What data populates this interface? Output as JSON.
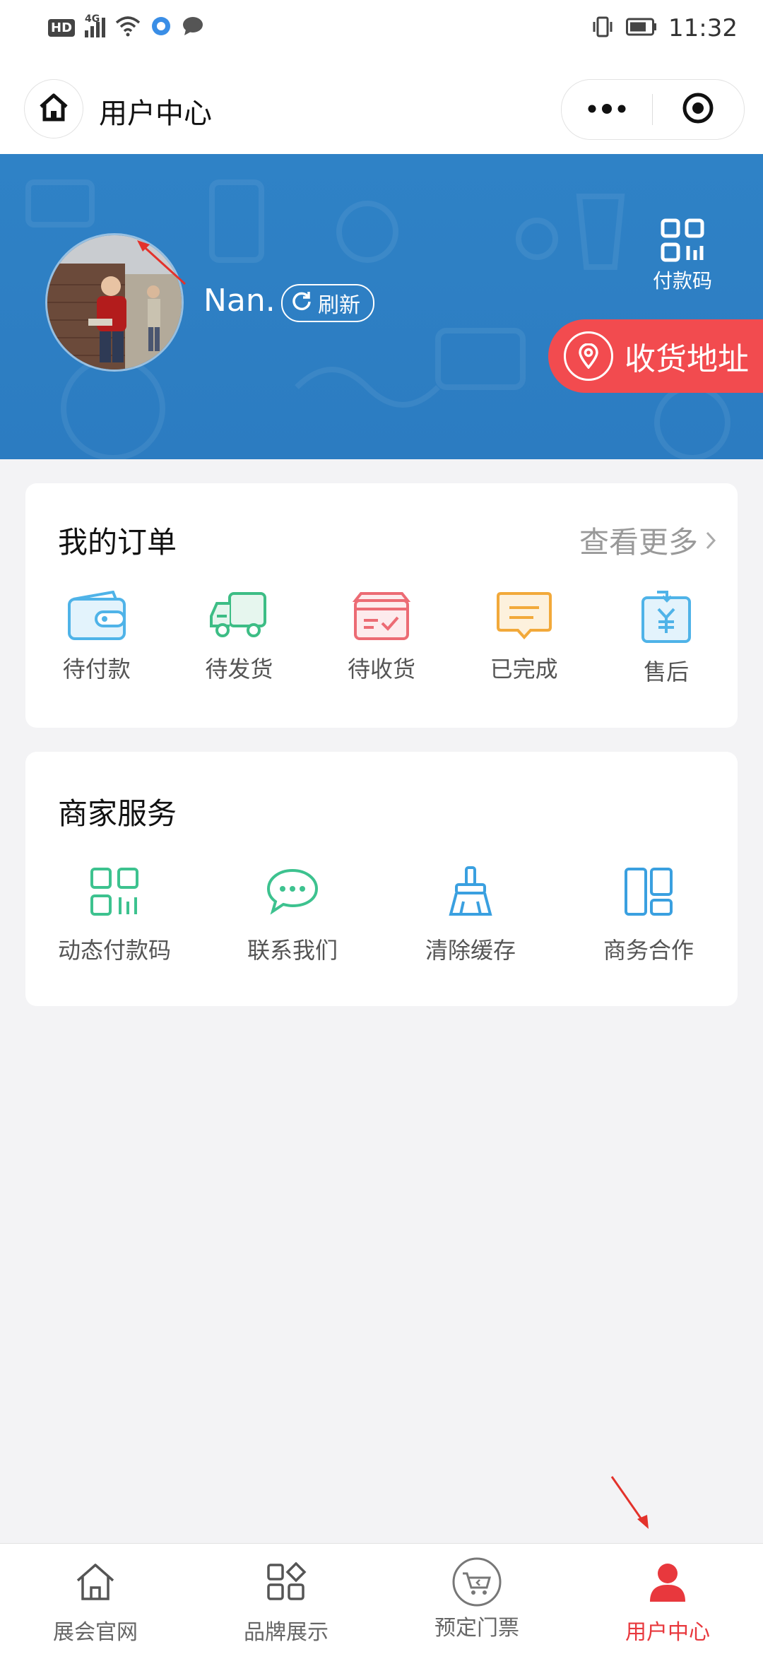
{
  "status_bar": {
    "left_icons": [
      "hd-icon",
      "signal-4g-icon",
      "wifi-icon",
      "app-notification-icon",
      "chat-bubble-icon"
    ],
    "hd_label": "HD",
    "network_label": "4G",
    "time": "11:32",
    "right_icons": [
      "vibrate-icon",
      "battery-icon"
    ]
  },
  "titlebar": {
    "title": "用户中心"
  },
  "banner": {
    "username": "Nan.",
    "refresh_label": "刷新",
    "pay_code_label": "付款码",
    "address_label": "收货地址",
    "bg_color": "#2f82c6",
    "address_color": "#f24b4f"
  },
  "orders": {
    "title": "我的订单",
    "more_label": "查看更多",
    "items": [
      {
        "label": "待付款",
        "icon": "wallet-icon"
      },
      {
        "label": "待发货",
        "icon": "truck-icon"
      },
      {
        "label": "待收货",
        "icon": "box-check-icon"
      },
      {
        "label": "已完成",
        "icon": "message-done-icon"
      },
      {
        "label": "售后",
        "icon": "yuan-refund-icon"
      }
    ]
  },
  "services": {
    "title": "商家服务",
    "items": [
      {
        "label": "动态付款码",
        "icon": "qr-code-icon"
      },
      {
        "label": "联系我们",
        "icon": "chat-icon"
      },
      {
        "label": "清除缓存",
        "icon": "broom-icon"
      },
      {
        "label": "商务合作",
        "icon": "layout-panels-icon"
      }
    ]
  },
  "tabbar": {
    "items": [
      {
        "label": "展会官网",
        "icon": "home-icon",
        "active": false
      },
      {
        "label": "品牌展示",
        "icon": "grid-apps-icon",
        "active": false
      },
      {
        "label": "预定门票",
        "icon": "cart-icon",
        "active": false
      },
      {
        "label": "用户中心",
        "icon": "user-icon",
        "active": true
      }
    ],
    "active_color": "#e8383d"
  }
}
